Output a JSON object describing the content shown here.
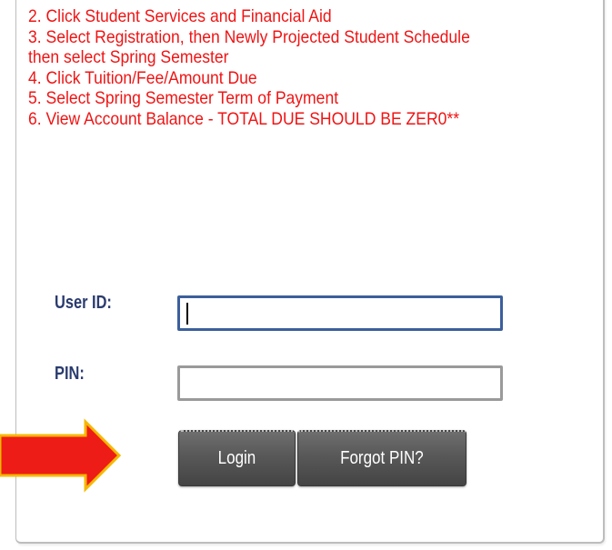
{
  "instructions": [
    "2. Click Student Services and Financial Aid",
    "3. Select Registration, then Newly Projected Student Schedule",
    "then select Spring Semester",
    "4. Click Tuition/Fee/Amount Due",
    "5. Select Spring Semester Term of Payment",
    "6. View Account Balance - TOTAL DUE SHOULD BE ZER0**"
  ],
  "login": {
    "user_id_label": "User ID:",
    "user_id_value": "",
    "pin_label": "PIN:",
    "pin_value": "",
    "login_button": "Login",
    "forgot_pin_button": "Forgot PIN?"
  },
  "colors": {
    "instruction_text": "#f01414",
    "label_text": "#2a3b6e",
    "arrow_fill": "#ee1c16",
    "arrow_outline": "#f5b800",
    "button_bg": "#555555"
  },
  "icons": {
    "arrow": "right-arrow-icon"
  }
}
